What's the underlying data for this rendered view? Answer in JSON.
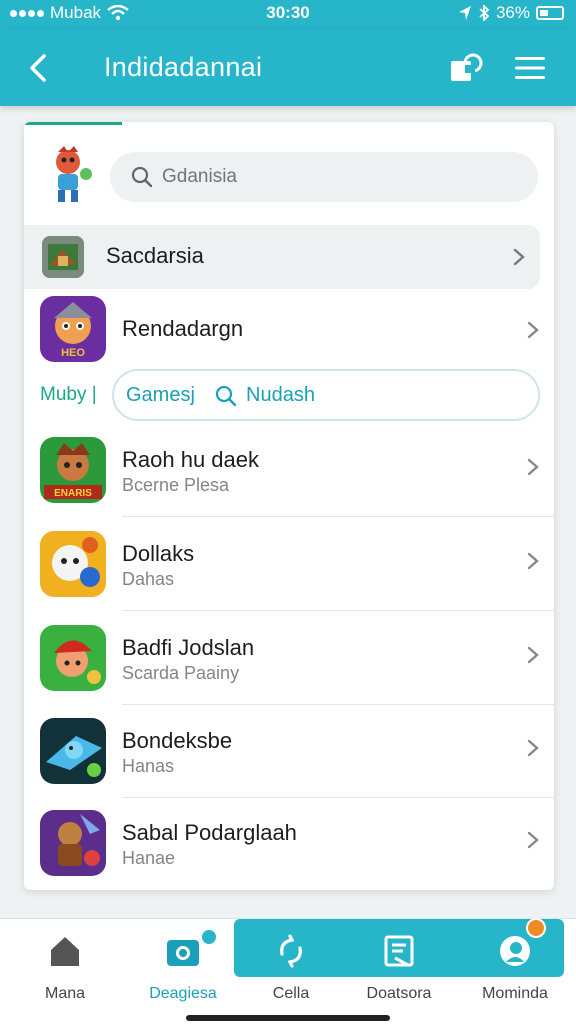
{
  "status_bar": {
    "carrier": "Mubak",
    "time": "30:30",
    "battery": "36%"
  },
  "app_bar": {
    "title": "Indidadannai",
    "back_icon": "chevron-left-icon",
    "action_icon": "note-icon",
    "menu_icon": "hamburger-menu-icon"
  },
  "search": {
    "placeholder": "Gdanisia"
  },
  "featured": {
    "label": "Sacdarsia"
  },
  "filter": {
    "label": "Muby |",
    "chip": "Gamesj",
    "query": "Nudash"
  },
  "apps": [
    {
      "title": "Rendadargn",
      "subtitle": "",
      "icon_text": "HEO"
    },
    {
      "title": "Raoh hu daek",
      "subtitle": "Bcerne Plesa",
      "icon_text": "ENARIS"
    },
    {
      "title": "Dollaks",
      "subtitle": "Dahas",
      "icon_text": ""
    },
    {
      "title": "Badfi Jodslan",
      "subtitle": "Scarda Paainy",
      "icon_text": ""
    },
    {
      "title": "Bondeksbe",
      "subtitle": "Hanas",
      "icon_text": ""
    },
    {
      "title": "Sabal Podarglaah",
      "subtitle": "Hanae",
      "icon_text": ""
    }
  ],
  "bottom_nav": [
    {
      "label": "Mana",
      "icon": "home-icon"
    },
    {
      "label": "Deagiesa",
      "icon": "camera-icon"
    },
    {
      "label": "Cella",
      "icon": "refresh-icon"
    },
    {
      "label": "Doatsora",
      "icon": "document-icon"
    },
    {
      "label": "Mominda",
      "icon": "profile-icon"
    }
  ],
  "colors": {
    "primary": "#27b5c9",
    "accent_green": "#1aa88a",
    "badge_orange": "#f08a24"
  }
}
